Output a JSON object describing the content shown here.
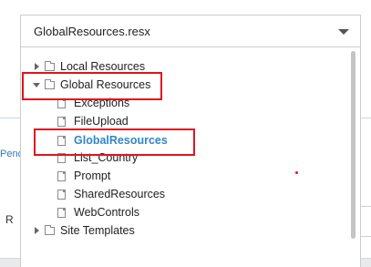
{
  "select": {
    "value": "GlobalResources.resx"
  },
  "background": {
    "pend_fragment": "Pend",
    "r_fragment": "R"
  },
  "tree": {
    "local_resources": "Local Resources",
    "global_resources": "Global Resources",
    "files": [
      "Exceptions",
      "FileUpload",
      "GlobalResources",
      "List_Country",
      "Prompt",
      "SharedResources",
      "WebControls"
    ],
    "site_templates": "Site Templates",
    "selected_item": "GlobalResources"
  },
  "colors": {
    "highlight_border": "#e0141e",
    "selected_text": "#2f86c8",
    "scrollbar": "#c4c4c4"
  }
}
